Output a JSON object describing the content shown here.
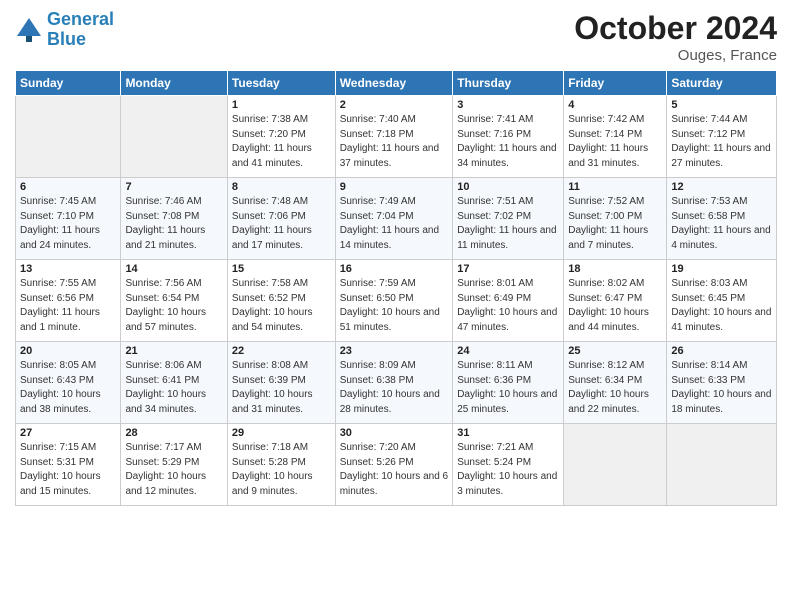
{
  "header": {
    "logo_line1": "General",
    "logo_line2": "Blue",
    "month": "October 2024",
    "location": "Ouges, France"
  },
  "days_of_week": [
    "Sunday",
    "Monday",
    "Tuesday",
    "Wednesday",
    "Thursday",
    "Friday",
    "Saturday"
  ],
  "weeks": [
    [
      {
        "day": "",
        "info": ""
      },
      {
        "day": "",
        "info": ""
      },
      {
        "day": "1",
        "info": "Sunrise: 7:38 AM\nSunset: 7:20 PM\nDaylight: 11 hours and 41 minutes."
      },
      {
        "day": "2",
        "info": "Sunrise: 7:40 AM\nSunset: 7:18 PM\nDaylight: 11 hours and 37 minutes."
      },
      {
        "day": "3",
        "info": "Sunrise: 7:41 AM\nSunset: 7:16 PM\nDaylight: 11 hours and 34 minutes."
      },
      {
        "day": "4",
        "info": "Sunrise: 7:42 AM\nSunset: 7:14 PM\nDaylight: 11 hours and 31 minutes."
      },
      {
        "day": "5",
        "info": "Sunrise: 7:44 AM\nSunset: 7:12 PM\nDaylight: 11 hours and 27 minutes."
      }
    ],
    [
      {
        "day": "6",
        "info": "Sunrise: 7:45 AM\nSunset: 7:10 PM\nDaylight: 11 hours and 24 minutes."
      },
      {
        "day": "7",
        "info": "Sunrise: 7:46 AM\nSunset: 7:08 PM\nDaylight: 11 hours and 21 minutes."
      },
      {
        "day": "8",
        "info": "Sunrise: 7:48 AM\nSunset: 7:06 PM\nDaylight: 11 hours and 17 minutes."
      },
      {
        "day": "9",
        "info": "Sunrise: 7:49 AM\nSunset: 7:04 PM\nDaylight: 11 hours and 14 minutes."
      },
      {
        "day": "10",
        "info": "Sunrise: 7:51 AM\nSunset: 7:02 PM\nDaylight: 11 hours and 11 minutes."
      },
      {
        "day": "11",
        "info": "Sunrise: 7:52 AM\nSunset: 7:00 PM\nDaylight: 11 hours and 7 minutes."
      },
      {
        "day": "12",
        "info": "Sunrise: 7:53 AM\nSunset: 6:58 PM\nDaylight: 11 hours and 4 minutes."
      }
    ],
    [
      {
        "day": "13",
        "info": "Sunrise: 7:55 AM\nSunset: 6:56 PM\nDaylight: 11 hours and 1 minute."
      },
      {
        "day": "14",
        "info": "Sunrise: 7:56 AM\nSunset: 6:54 PM\nDaylight: 10 hours and 57 minutes."
      },
      {
        "day": "15",
        "info": "Sunrise: 7:58 AM\nSunset: 6:52 PM\nDaylight: 10 hours and 54 minutes."
      },
      {
        "day": "16",
        "info": "Sunrise: 7:59 AM\nSunset: 6:50 PM\nDaylight: 10 hours and 51 minutes."
      },
      {
        "day": "17",
        "info": "Sunrise: 8:01 AM\nSunset: 6:49 PM\nDaylight: 10 hours and 47 minutes."
      },
      {
        "day": "18",
        "info": "Sunrise: 8:02 AM\nSunset: 6:47 PM\nDaylight: 10 hours and 44 minutes."
      },
      {
        "day": "19",
        "info": "Sunrise: 8:03 AM\nSunset: 6:45 PM\nDaylight: 10 hours and 41 minutes."
      }
    ],
    [
      {
        "day": "20",
        "info": "Sunrise: 8:05 AM\nSunset: 6:43 PM\nDaylight: 10 hours and 38 minutes."
      },
      {
        "day": "21",
        "info": "Sunrise: 8:06 AM\nSunset: 6:41 PM\nDaylight: 10 hours and 34 minutes."
      },
      {
        "day": "22",
        "info": "Sunrise: 8:08 AM\nSunset: 6:39 PM\nDaylight: 10 hours and 31 minutes."
      },
      {
        "day": "23",
        "info": "Sunrise: 8:09 AM\nSunset: 6:38 PM\nDaylight: 10 hours and 28 minutes."
      },
      {
        "day": "24",
        "info": "Sunrise: 8:11 AM\nSunset: 6:36 PM\nDaylight: 10 hours and 25 minutes."
      },
      {
        "day": "25",
        "info": "Sunrise: 8:12 AM\nSunset: 6:34 PM\nDaylight: 10 hours and 22 minutes."
      },
      {
        "day": "26",
        "info": "Sunrise: 8:14 AM\nSunset: 6:33 PM\nDaylight: 10 hours and 18 minutes."
      }
    ],
    [
      {
        "day": "27",
        "info": "Sunrise: 7:15 AM\nSunset: 5:31 PM\nDaylight: 10 hours and 15 minutes."
      },
      {
        "day": "28",
        "info": "Sunrise: 7:17 AM\nSunset: 5:29 PM\nDaylight: 10 hours and 12 minutes."
      },
      {
        "day": "29",
        "info": "Sunrise: 7:18 AM\nSunset: 5:28 PM\nDaylight: 10 hours and 9 minutes."
      },
      {
        "day": "30",
        "info": "Sunrise: 7:20 AM\nSunset: 5:26 PM\nDaylight: 10 hours and 6 minutes."
      },
      {
        "day": "31",
        "info": "Sunrise: 7:21 AM\nSunset: 5:24 PM\nDaylight: 10 hours and 3 minutes."
      },
      {
        "day": "",
        "info": ""
      },
      {
        "day": "",
        "info": ""
      }
    ]
  ]
}
